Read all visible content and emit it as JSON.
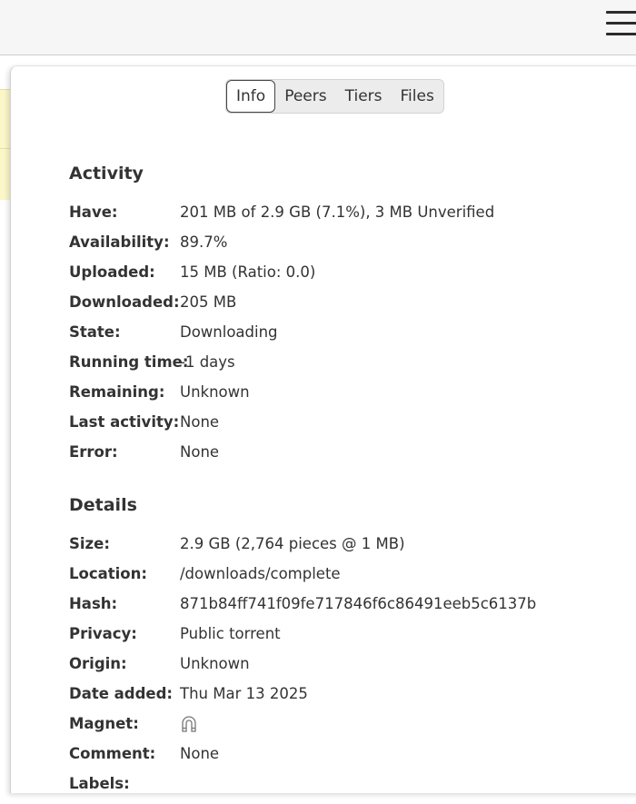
{
  "tabs": [
    {
      "label": "Info",
      "active": true
    },
    {
      "label": "Peers",
      "active": false
    },
    {
      "label": "Tiers",
      "active": false
    },
    {
      "label": "Files",
      "active": false
    }
  ],
  "activity": {
    "title": "Activity",
    "have": {
      "label": "Have:",
      "value": "201 MB of 2.9 GB (7.1%), 3 MB Unverified"
    },
    "availability": {
      "label": "Availability:",
      "value": "89.7%"
    },
    "uploaded": {
      "label": "Uploaded:",
      "value": "15 MB (Ratio: 0.0)"
    },
    "downloaded": {
      "label": "Downloaded:",
      "value": "205 MB"
    },
    "state": {
      "label": "State:",
      "value": "Downloading"
    },
    "running_time": {
      "label": "Running time:",
      "value": "-1 days"
    },
    "remaining": {
      "label": "Remaining:",
      "value": "Unknown"
    },
    "last_activity": {
      "label": "Last activity:",
      "value": "None"
    },
    "error": {
      "label": "Error:",
      "value": "None"
    }
  },
  "details": {
    "title": "Details",
    "size": {
      "label": "Size:",
      "value": "2.9 GB (2,764 pieces @ 1 MB)"
    },
    "location": {
      "label": "Location:",
      "value": "/downloads/complete"
    },
    "hash": {
      "label": "Hash:",
      "value": "871b84ff741f09fe717846f6c86491eeb5c6137b"
    },
    "privacy": {
      "label": "Privacy:",
      "value": "Public torrent"
    },
    "origin": {
      "label": "Origin:",
      "value": "Unknown"
    },
    "date_added": {
      "label": "Date added:",
      "value": "Thu Mar 13 2025"
    },
    "magnet": {
      "label": "Magnet:",
      "icon": "magnet-icon"
    },
    "comment": {
      "label": "Comment:",
      "value": "None"
    },
    "labels": {
      "label": "Labels:"
    }
  },
  "icons": {
    "menu": "hamburger-menu-icon",
    "magnet": "magnet-icon"
  },
  "colors": {
    "bar": "#f6f6f6",
    "list_row": "#fbf7c9",
    "text": "#333333",
    "tab_group": "#ececec"
  }
}
